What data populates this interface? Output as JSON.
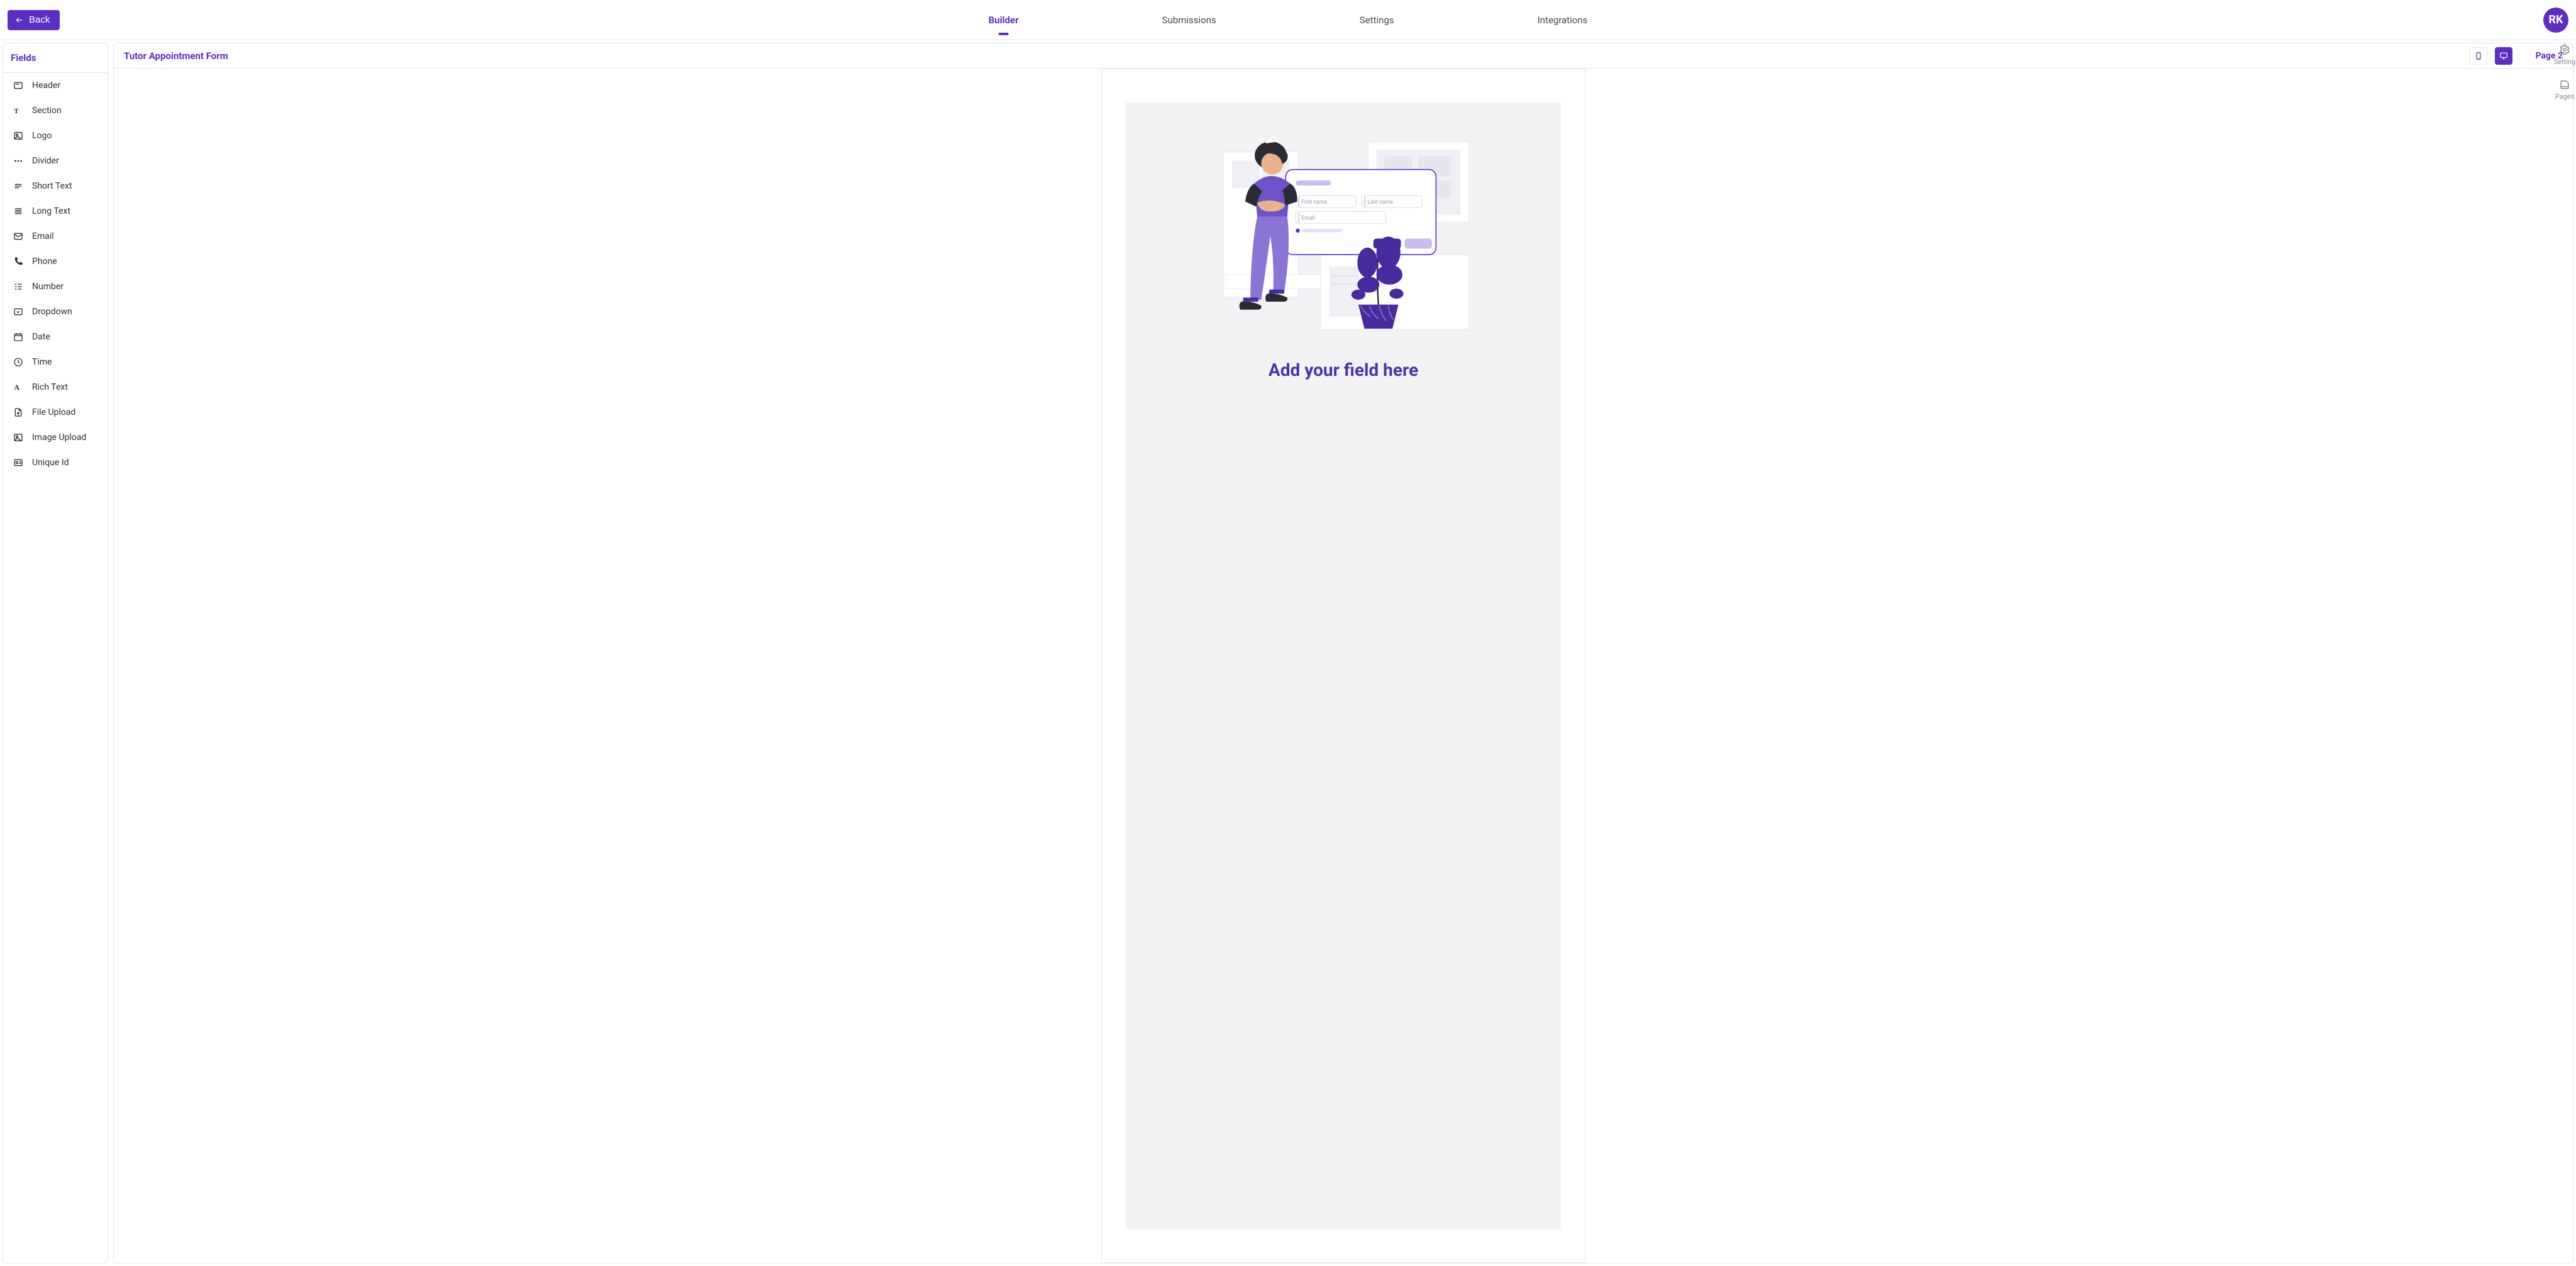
{
  "header": {
    "back_label": "Back",
    "tabs": [
      "Builder",
      "Submissions",
      "Settings",
      "Integrations"
    ],
    "active_tab_index": 0,
    "avatar_initials": "RK"
  },
  "sidebar": {
    "title": "Fields",
    "items": [
      {
        "label": "Header",
        "icon": "header-icon"
      },
      {
        "label": "Section",
        "icon": "section-icon"
      },
      {
        "label": "Logo",
        "icon": "logo-icon"
      },
      {
        "label": "Divider",
        "icon": "divider-icon"
      },
      {
        "label": "Short Text",
        "icon": "short-text-icon"
      },
      {
        "label": "Long Text",
        "icon": "long-text-icon"
      },
      {
        "label": "Email",
        "icon": "email-icon"
      },
      {
        "label": "Phone",
        "icon": "phone-icon"
      },
      {
        "label": "Number",
        "icon": "number-icon"
      },
      {
        "label": "Dropdown",
        "icon": "dropdown-icon"
      },
      {
        "label": "Date",
        "icon": "date-icon"
      },
      {
        "label": "Time",
        "icon": "time-icon"
      },
      {
        "label": "Rich Text",
        "icon": "rich-text-icon"
      },
      {
        "label": "File Upload",
        "icon": "file-upload-icon"
      },
      {
        "label": "Image Upload",
        "icon": "image-upload-icon"
      },
      {
        "label": "Unique Id",
        "icon": "unique-id-icon"
      }
    ]
  },
  "main": {
    "form_title": "Tutor Appointment Form",
    "page_label": "Page 2",
    "empty": {
      "headline": "Add your field here",
      "placeholder_first_name": "First name",
      "placeholder_last_name": "Last name",
      "placeholder_email": "Email"
    }
  },
  "right_rail": {
    "setting_label": "Setting",
    "pages_label": "Pages"
  }
}
